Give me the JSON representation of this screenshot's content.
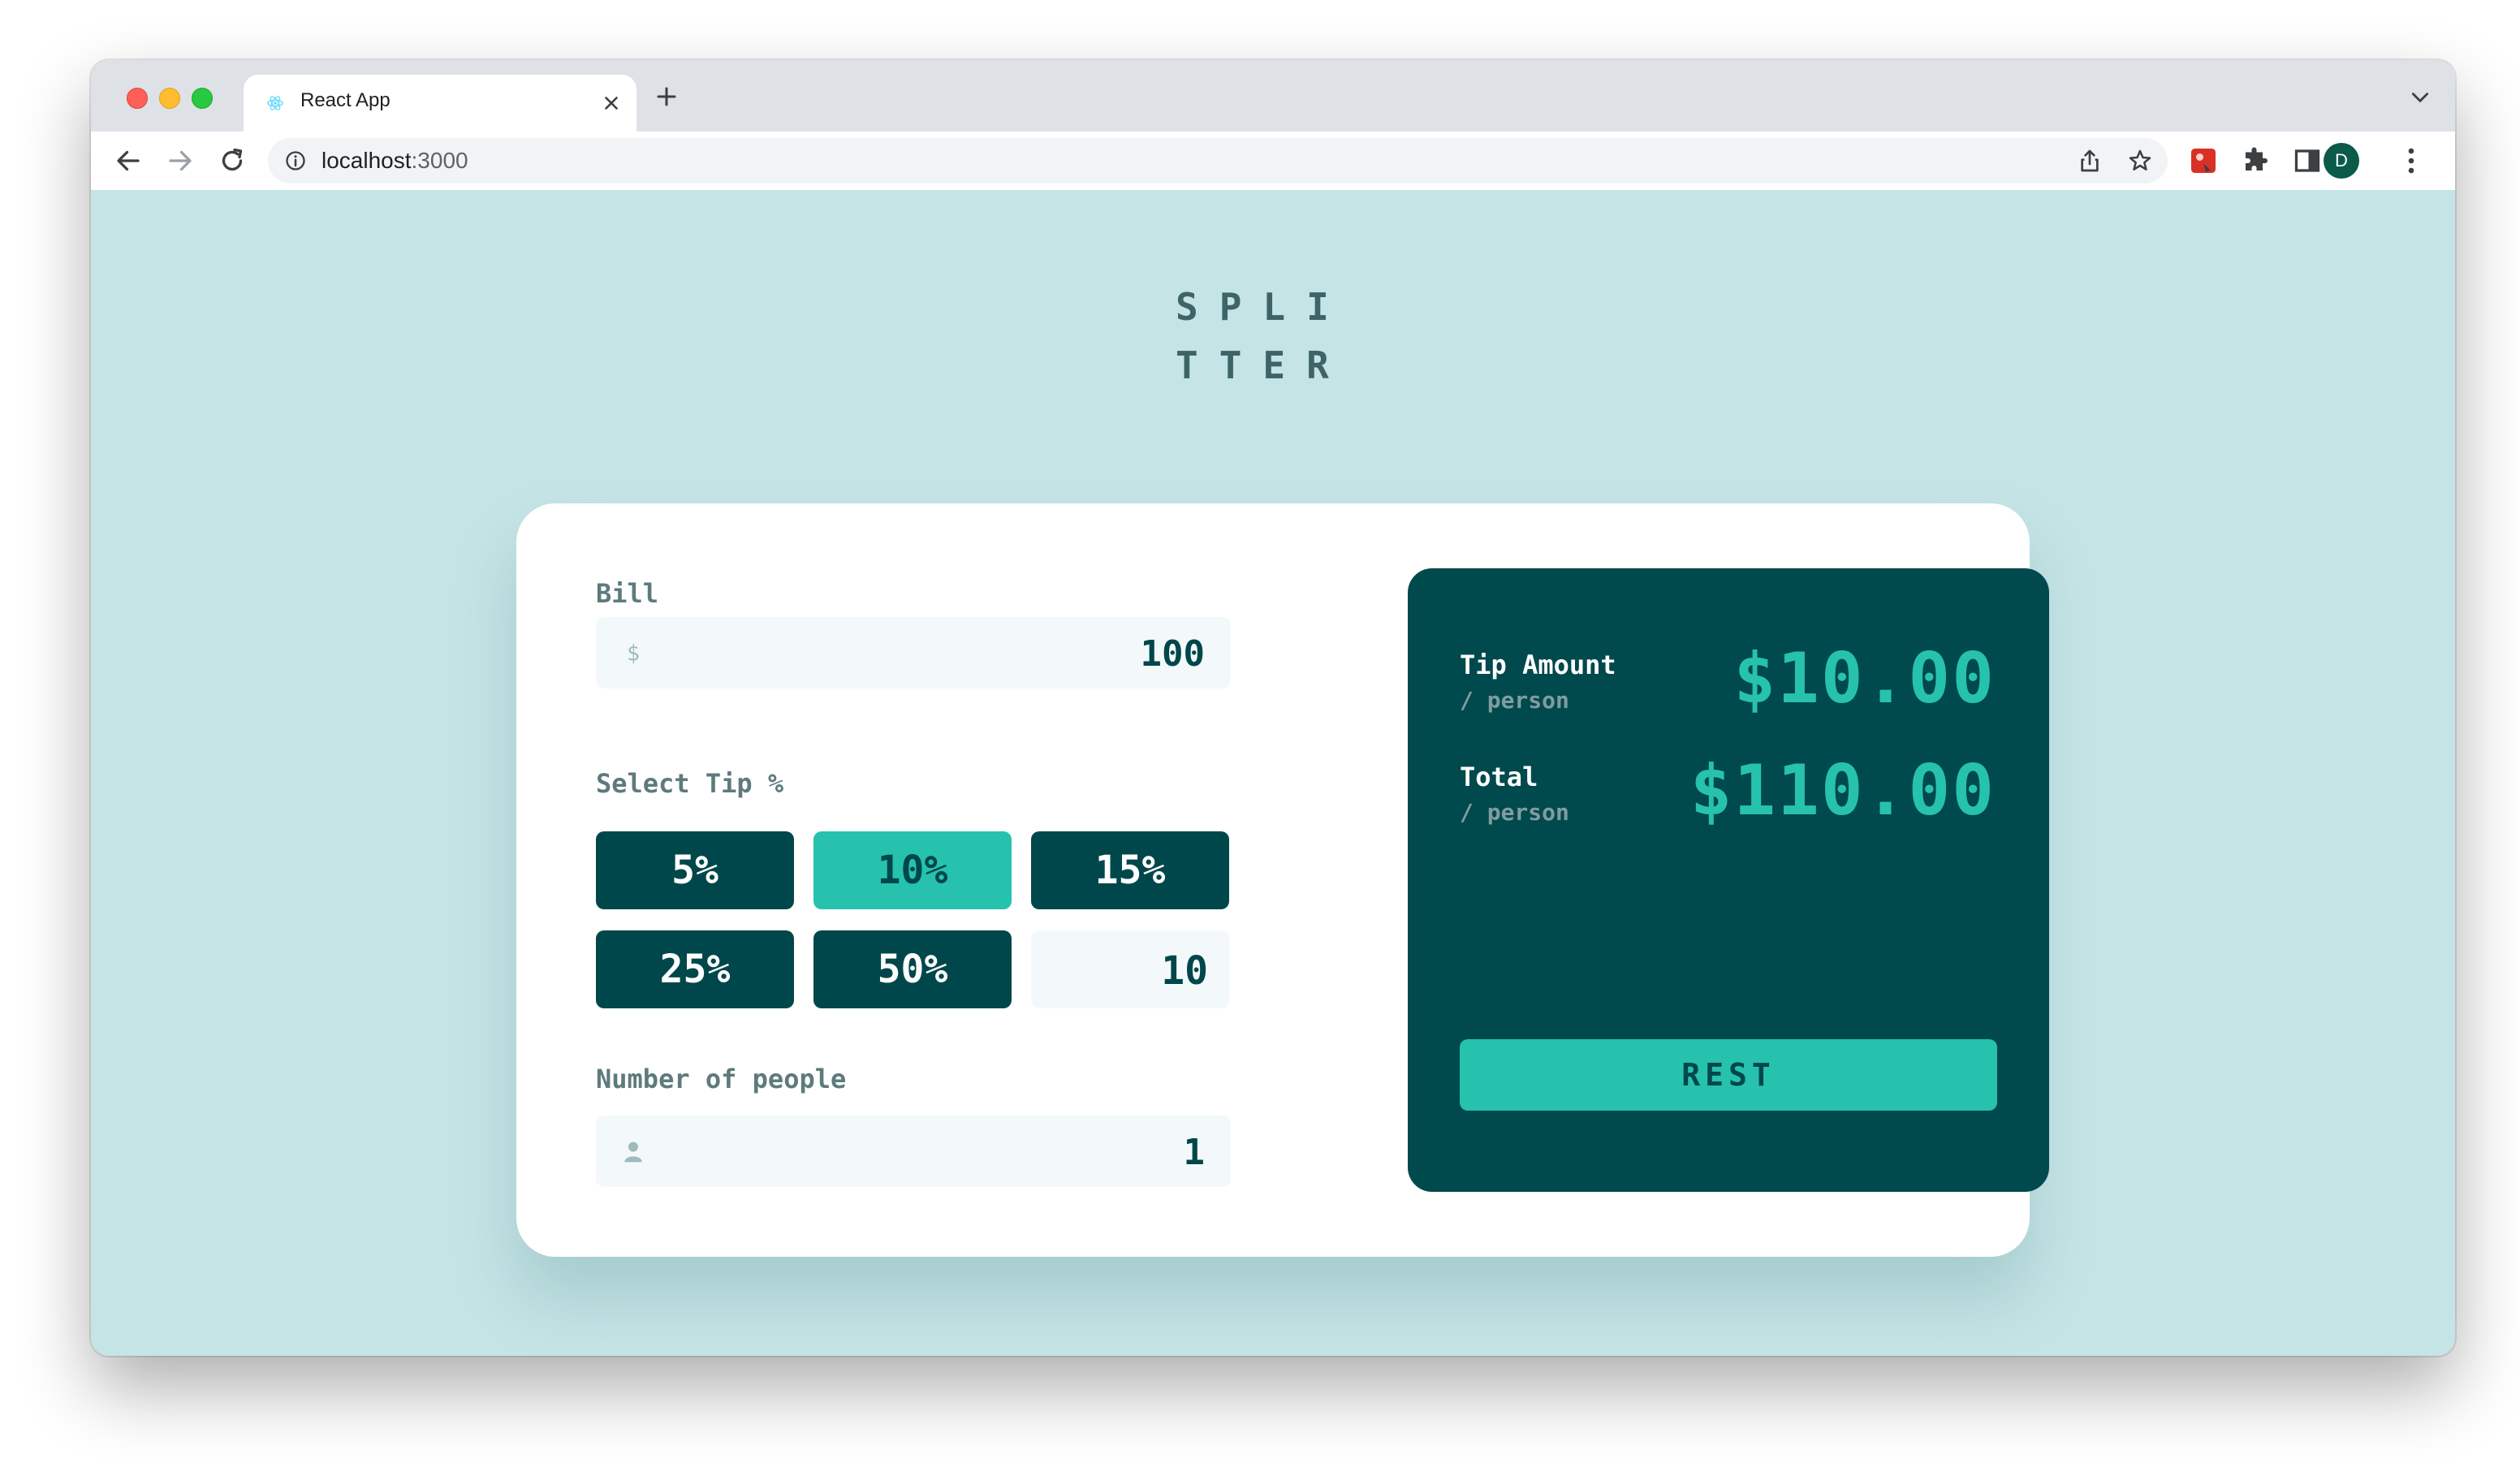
{
  "browser": {
    "tab_title": "React App",
    "url_host": "localhost",
    "url_port": ":3000",
    "profile_initial": "D"
  },
  "app": {
    "logo_line1": "SPLI",
    "logo_line2": "TTER",
    "bill_label": "Bill",
    "bill_value": "100",
    "tip_label": "Select Tip %",
    "tip_options": [
      "5%",
      "10%",
      "15%",
      "25%",
      "50%"
    ],
    "tip_selected": "10%",
    "tip_custom_value": "10",
    "people_label": "Number of people",
    "people_value": "1",
    "tip_amount_label": "Tip Amount",
    "per_person": "/ person",
    "tip_amount_value": "$10.00",
    "total_label": "Total",
    "total_value": "$110.00",
    "reset_label": "REST"
  },
  "colors": {
    "background": "#c5e4e6",
    "dark_teal": "#00474b",
    "accent": "#26c2ae"
  }
}
